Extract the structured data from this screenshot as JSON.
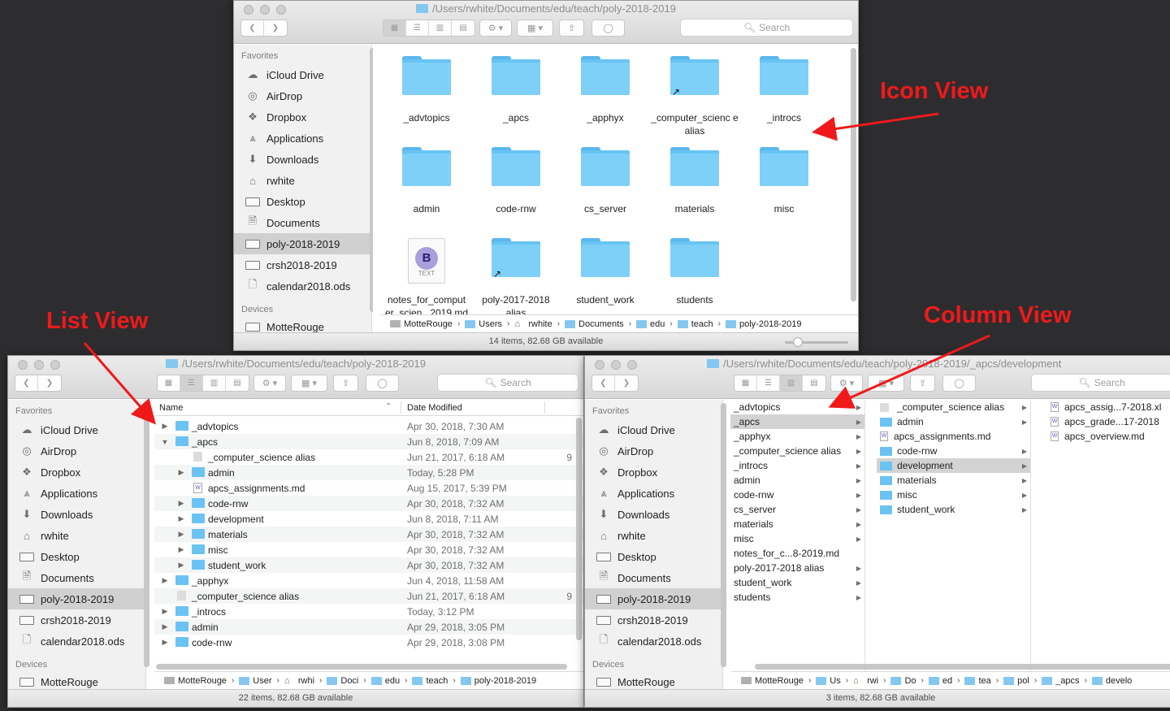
{
  "annotations": {
    "icon_view": "Icon View",
    "list_view": "List View",
    "column_view": "Column View"
  },
  "toolbar": {
    "search": "Search"
  },
  "sidebar": {
    "favorites_header": "Favorites",
    "devices_header": "Devices",
    "items": [
      {
        "label": "iCloud Drive",
        "icon": "cloud-icon"
      },
      {
        "label": "AirDrop",
        "icon": "airdrop-icon"
      },
      {
        "label": "Dropbox",
        "icon": "dropbox-icon"
      },
      {
        "label": "Applications",
        "icon": "applications-icon"
      },
      {
        "label": "Downloads",
        "icon": "downloads-icon"
      },
      {
        "label": "rwhite",
        "icon": "home-icon"
      },
      {
        "label": "Desktop",
        "icon": "desktop-icon"
      },
      {
        "label": "Documents",
        "icon": "documents-icon"
      },
      {
        "label": "poly-2018-2019",
        "icon": "folder-icon",
        "selected": true
      },
      {
        "label": "crsh2018-2019",
        "icon": "folder-icon"
      },
      {
        "label": "calendar2018.ods",
        "icon": "document-icon"
      }
    ],
    "device": "MotteRouge"
  },
  "icon_window": {
    "title": "/Users/rwhite/Documents/edu/teach/poly-2018-2019",
    "items": [
      {
        "label": "_advtopics",
        "alias": false
      },
      {
        "label": "_apcs",
        "alias": false
      },
      {
        "label": "_apphyx",
        "alias": false
      },
      {
        "label": "_computer_scienc e alias",
        "alias": true
      },
      {
        "label": "_introcs",
        "alias": false
      },
      {
        "label": "admin",
        "alias": false
      },
      {
        "label": "code-rnw",
        "alias": false
      },
      {
        "label": "cs_server",
        "alias": false
      },
      {
        "label": "materials",
        "alias": false
      },
      {
        "label": "misc",
        "alias": false
      },
      {
        "label": "notes_for_comput er_scien...2019.md",
        "alias": false,
        "doc": true,
        "doc_letter": "B",
        "doc_type": "TEXT"
      },
      {
        "label": "poly-2017-2018 alias",
        "alias": true
      },
      {
        "label": "student_work",
        "alias": false
      },
      {
        "label": "students",
        "alias": false
      }
    ],
    "path": [
      "MotteRouge",
      "Users",
      "rwhite",
      "Documents",
      "edu",
      "teach",
      "poly-2018-2019"
    ],
    "status": "14 items, 82.68 GB available"
  },
  "list_window": {
    "title": "/Users/rwhite/Documents/edu/teach/poly-2018-2019",
    "col_name": "Name",
    "col_date": "Date Modified",
    "rows": [
      {
        "name": "_advtopics",
        "date": "Apr 30, 2018, 7:30 AM",
        "level": 0,
        "tri": "▶",
        "kind": "folder",
        "size": ""
      },
      {
        "name": "_apcs",
        "date": "Jun 8, 2018, 7:09 AM",
        "level": 0,
        "tri": "▼",
        "kind": "folder",
        "size": ""
      },
      {
        "name": "_computer_science alias",
        "date": "Jun 21, 2017, 6:18 AM",
        "level": 1,
        "tri": "",
        "kind": "alias",
        "size": "9"
      },
      {
        "name": "admin",
        "date": "Today, 5:28 PM",
        "level": 1,
        "tri": "▶",
        "kind": "folder",
        "size": ""
      },
      {
        "name": "apcs_assignments.md",
        "date": "Aug 15, 2017, 5:39 PM",
        "level": 1,
        "tri": "",
        "kind": "doc",
        "size": ""
      },
      {
        "name": "code-rnw",
        "date": "Apr 30, 2018, 7:32 AM",
        "level": 1,
        "tri": "▶",
        "kind": "folder",
        "size": ""
      },
      {
        "name": "development",
        "date": "Jun 8, 2018, 7:11 AM",
        "level": 1,
        "tri": "▶",
        "kind": "folder",
        "size": ""
      },
      {
        "name": "materials",
        "date": "Apr 30, 2018, 7:32 AM",
        "level": 1,
        "tri": "▶",
        "kind": "folder",
        "size": ""
      },
      {
        "name": "misc",
        "date": "Apr 30, 2018, 7:32 AM",
        "level": 1,
        "tri": "▶",
        "kind": "folder",
        "size": ""
      },
      {
        "name": "student_work",
        "date": "Apr 30, 2018, 7:32 AM",
        "level": 1,
        "tri": "▶",
        "kind": "folder",
        "size": ""
      },
      {
        "name": "_apphyx",
        "date": "Jun 4, 2018, 11:58 AM",
        "level": 0,
        "tri": "▶",
        "kind": "folder",
        "size": ""
      },
      {
        "name": "_computer_science alias",
        "date": "Jun 21, 2017, 6:18 AM",
        "level": 0,
        "tri": "",
        "kind": "alias",
        "size": "9"
      },
      {
        "name": "_introcs",
        "date": "Today, 3:12 PM",
        "level": 0,
        "tri": "▶",
        "kind": "folder",
        "size": ""
      },
      {
        "name": "admin",
        "date": "Apr 29, 2018, 3:05 PM",
        "level": 0,
        "tri": "▶",
        "kind": "folder",
        "size": ""
      },
      {
        "name": "code-rnw",
        "date": "Apr 29, 2018, 3:08 PM",
        "level": 0,
        "tri": "▶",
        "kind": "folder",
        "size": ""
      }
    ],
    "path": [
      "MotteRouge",
      "User",
      "rwhi",
      "Doci",
      "edu",
      "teach",
      "poly-2018-2019"
    ],
    "status": "22 items, 82.68 GB available"
  },
  "column_window": {
    "title": "/Users/rwhite/Documents/edu/teach/poly-2018-2019/_apcs/development",
    "col1": [
      {
        "name": "_advtopics",
        "arrow": true
      },
      {
        "name": "_apcs",
        "arrow": true,
        "selected": true
      },
      {
        "name": "_apphyx",
        "arrow": true
      },
      {
        "name": "_computer_science alias",
        "arrow": true
      },
      {
        "name": "_introcs",
        "arrow": true
      },
      {
        "name": "admin",
        "arrow": true
      },
      {
        "name": "code-rnw",
        "arrow": true
      },
      {
        "name": "cs_server",
        "arrow": true
      },
      {
        "name": "materials",
        "arrow": true
      },
      {
        "name": "misc",
        "arrow": true
      },
      {
        "name": "notes_for_c...8-2019.md",
        "arrow": false
      },
      {
        "name": "poly-2017-2018 alias",
        "arrow": true
      },
      {
        "name": "student_work",
        "arrow": true
      },
      {
        "name": "students",
        "arrow": true
      }
    ],
    "col2": [
      {
        "name": "_computer_science alias",
        "arrow": true,
        "kind": "alias"
      },
      {
        "name": "admin",
        "arrow": true,
        "kind": "folder"
      },
      {
        "name": "apcs_assignments.md",
        "arrow": false,
        "kind": "doc"
      },
      {
        "name": "code-rnw",
        "arrow": true,
        "kind": "folder"
      },
      {
        "name": "development",
        "arrow": true,
        "kind": "folder",
        "selected": true
      },
      {
        "name": "materials",
        "arrow": true,
        "kind": "folder"
      },
      {
        "name": "misc",
        "arrow": true,
        "kind": "folder"
      },
      {
        "name": "student_work",
        "arrow": true,
        "kind": "folder"
      }
    ],
    "col3": [
      {
        "name": "apcs_assig...7-2018.xl",
        "kind": "doc"
      },
      {
        "name": "apcs_grade...17-2018",
        "kind": "doc"
      },
      {
        "name": "apcs_overview.md",
        "kind": "doc"
      }
    ],
    "path": [
      "MotteRouge",
      "Us",
      "rwi",
      "Do",
      "ed",
      "tea",
      "pol",
      "_apcs",
      "develo"
    ],
    "status": "3 items, 82.68 GB available"
  }
}
